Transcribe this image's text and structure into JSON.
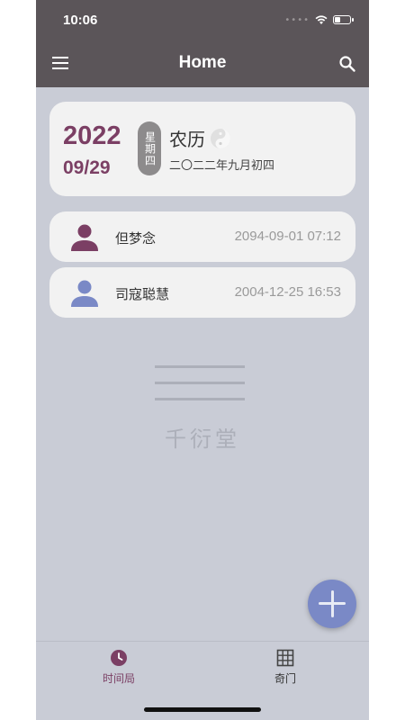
{
  "status_bar": {
    "time": "10:06"
  },
  "app_bar": {
    "title": "Home",
    "menu_icon": "hamburger-menu-icon",
    "search_icon": "search-icon"
  },
  "date_card": {
    "year": "2022",
    "month_day": "09/29",
    "weekday": "星期四",
    "lunar_label": "农历",
    "lunar_icon": "yin-yang-icon",
    "lunar_date": "二〇二二年九月初四"
  },
  "records": [
    {
      "name": "但梦念",
      "datetime": "2094-09-01 07:12",
      "avatar_color": "#7b3f64"
    },
    {
      "name": "司寇聪慧",
      "datetime": "2004-12-25 16:53",
      "avatar_color": "#7a89c6"
    }
  ],
  "watermark": {
    "text": "千衍堂"
  },
  "fab": {
    "icon": "plus-icon"
  },
  "tabs": [
    {
      "label": "时间局",
      "icon": "clock-icon",
      "active": true
    },
    {
      "label": "奇门",
      "icon": "grid-icon",
      "active": false
    }
  ],
  "colors": {
    "accent": "#7b3f64",
    "bar": "#5b5559",
    "fab": "#7a89c6",
    "background": "#c9ccd6"
  }
}
